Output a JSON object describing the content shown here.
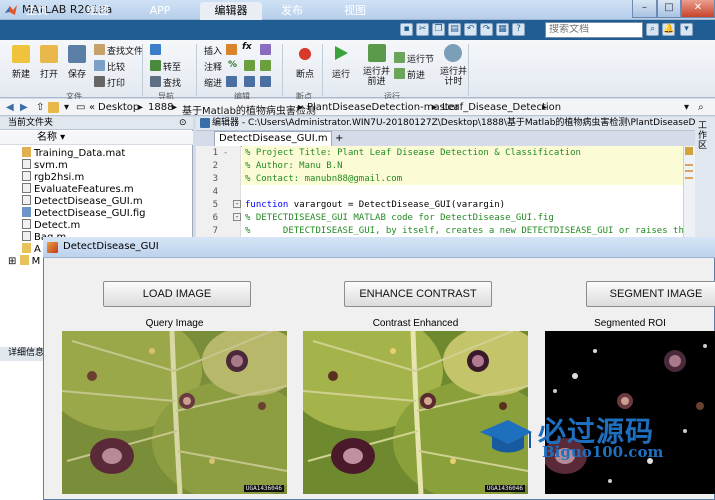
{
  "window": {
    "title": "MATLAB R2018a",
    "minimize": "–",
    "maximize": "□",
    "close": "✕"
  },
  "tabs": [
    {
      "label": "主页"
    },
    {
      "label": "绘图"
    },
    {
      "label": "APP"
    },
    {
      "label": "编辑器"
    },
    {
      "label": "发布"
    },
    {
      "label": "视图"
    }
  ],
  "search": {
    "placeholder": "搜索文档"
  },
  "ribbon": {
    "file": {
      "new": "新建",
      "open": "打开",
      "save": "保存",
      "find_files": "查找文件",
      "compare": "比较",
      "print": "打印",
      "group": "文件"
    },
    "navigate": {
      "goto": "转至",
      "find": "查找",
      "group": "导航"
    },
    "edit": {
      "insert": "插入",
      "comment": "注释",
      "indent": "缩进",
      "fx": "fx",
      "pct": "%",
      "group": "编辑"
    },
    "breakpoints": {
      "label": "断点",
      "group": "断点"
    },
    "run": {
      "run": "运行",
      "run_advance": "运行并\n前进",
      "run_section": "运行节",
      "advance": "前进",
      "run_time": "运行并\n计时",
      "group": "运行"
    }
  },
  "address": {
    "crumbs": [
      "«",
      "Desktop",
      "1888",
      "基于Matlab的植物病虫害检测",
      "PlantDiseaseDetection-master",
      "Leaf_Disease_Detection"
    ]
  },
  "left_panel": {
    "header": "当前文件夹",
    "column": "名称",
    "files": [
      {
        "name": "Training_Data.mat",
        "kind": "mat"
      },
      {
        "name": "svm.m",
        "kind": "m"
      },
      {
        "name": "rgb2hsi.m",
        "kind": "m"
      },
      {
        "name": "EvaluateFeatures.m",
        "kind": "m"
      },
      {
        "name": "DetectDisease_GUI.m",
        "kind": "m"
      },
      {
        "name": "DetectDisease_GUI.fig",
        "kind": "fig"
      },
      {
        "name": "Detect.m",
        "kind": "m"
      },
      {
        "name": "Bag.m",
        "kind": "m"
      },
      {
        "name": "A",
        "kind": "folder"
      },
      {
        "name": "M",
        "kind": "folder"
      }
    ],
    "details": "详细信息"
  },
  "editor": {
    "title": "编辑器 - C:\\Users\\Administrator.WIN7U-20180127Z\\Desktop\\1888\\基于Matlab的植物病虫害检测\\PlantDiseaseDe...",
    "tab": "DetectDisease_GUI.m",
    "lines": [
      {
        "n": "1",
        "text": "% Project Title: Plant Leaf Disease Detection & Classification",
        "type": "cmt"
      },
      {
        "n": "2",
        "text": "% Author: Manu B.N",
        "type": "cmt"
      },
      {
        "n": "3",
        "text": "% Contact: manubn88@gmail.com",
        "type": "cmt"
      },
      {
        "n": "4",
        "text": "",
        "type": "cmt"
      },
      {
        "n": "5",
        "text": "function varargout = DetectDisease_GUI(varargin)",
        "type": "fn"
      },
      {
        "n": "6",
        "text": "% DETECTDISEASE_GUI MATLAB code for DetectDisease_GUI.fig",
        "type": "cmt"
      },
      {
        "n": "7",
        "text": "%      DETECTDISEASE_GUI, by itself, creates a new DETECTDISEASE_GUI or raises the exist",
        "type": "cmt"
      }
    ]
  },
  "right_strip": {
    "label": "工作区"
  },
  "figure": {
    "title": "DetectDisease_GUI",
    "buttons": {
      "load": "LOAD IMAGE",
      "enhance": "ENHANCE CONTRAST",
      "segment": "SEGMENT IMAGE"
    },
    "captions": {
      "query": "Query Image",
      "contrast": "Contrast Enhanced",
      "segmented": "Segmented ROI"
    },
    "stamp": "UGA1436046"
  },
  "watermark": {
    "title": "必过源码",
    "url": "Biguo100.com"
  }
}
